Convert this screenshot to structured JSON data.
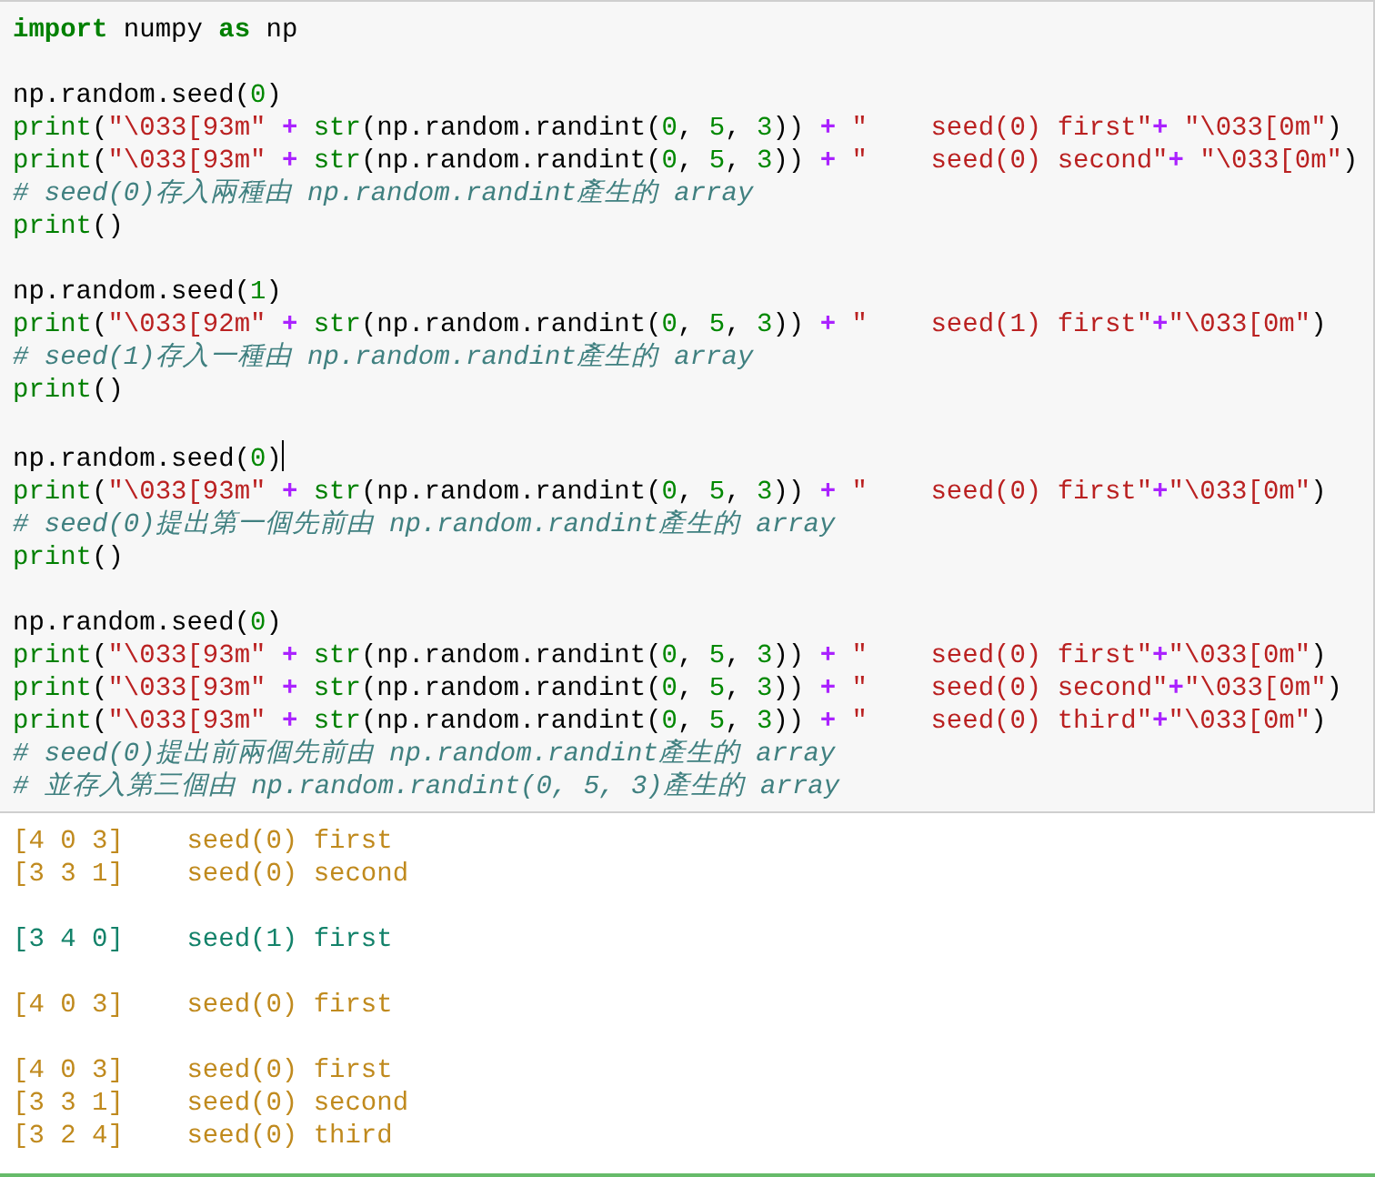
{
  "code_cell": {
    "lines": [
      {
        "tokens": [
          {
            "kind": "keyword",
            "text": "import"
          },
          {
            "kind": "name",
            "text": " numpy "
          },
          {
            "kind": "keyword",
            "text": "as"
          },
          {
            "kind": "name",
            "text": " np"
          }
        ]
      },
      {
        "blank_before": true,
        "tokens": [
          {
            "kind": "name",
            "text": "np.random.seed("
          },
          {
            "kind": "number",
            "text": "0"
          },
          {
            "kind": "name",
            "text": ")"
          }
        ]
      },
      {
        "tokens": [
          {
            "kind": "builtin",
            "text": "print"
          },
          {
            "kind": "name",
            "text": "("
          },
          {
            "kind": "string",
            "text": "\"\\033[93m\" "
          },
          {
            "kind": "operator",
            "text": "+ "
          },
          {
            "kind": "builtin",
            "text": "str"
          },
          {
            "kind": "name",
            "text": "(np.random.randint("
          },
          {
            "kind": "number",
            "text": "0"
          },
          {
            "kind": "name",
            "text": ", "
          },
          {
            "kind": "number",
            "text": "5"
          },
          {
            "kind": "name",
            "text": ", "
          },
          {
            "kind": "number",
            "text": "3"
          },
          {
            "kind": "name",
            "text": ")) "
          },
          {
            "kind": "operator",
            "text": "+ "
          },
          {
            "kind": "string",
            "text": "\"    seed(0) first\""
          },
          {
            "kind": "operator",
            "text": "+ "
          },
          {
            "kind": "string",
            "text": "\"\\033[0m\""
          },
          {
            "kind": "name",
            "text": ")"
          }
        ]
      },
      {
        "tokens": [
          {
            "kind": "builtin",
            "text": "print"
          },
          {
            "kind": "name",
            "text": "("
          },
          {
            "kind": "string",
            "text": "\"\\033[93m\" "
          },
          {
            "kind": "operator",
            "text": "+ "
          },
          {
            "kind": "builtin",
            "text": "str"
          },
          {
            "kind": "name",
            "text": "(np.random.randint("
          },
          {
            "kind": "number",
            "text": "0"
          },
          {
            "kind": "name",
            "text": ", "
          },
          {
            "kind": "number",
            "text": "5"
          },
          {
            "kind": "name",
            "text": ", "
          },
          {
            "kind": "number",
            "text": "3"
          },
          {
            "kind": "name",
            "text": ")) "
          },
          {
            "kind": "operator",
            "text": "+ "
          },
          {
            "kind": "string",
            "text": "\"    seed(0) second\""
          },
          {
            "kind": "operator",
            "text": "+ "
          },
          {
            "kind": "string",
            "text": "\"\\033[0m\""
          },
          {
            "kind": "name",
            "text": ")"
          }
        ]
      },
      {
        "tokens": [
          {
            "kind": "comment",
            "text": "# seed(0)存入兩種由 np.random.randint產生的 array"
          }
        ]
      },
      {
        "tokens": [
          {
            "kind": "builtin",
            "text": "print"
          },
          {
            "kind": "name",
            "text": "()"
          }
        ]
      },
      {
        "blank_before": true,
        "tokens": [
          {
            "kind": "name",
            "text": "np.random.seed("
          },
          {
            "kind": "number",
            "text": "1"
          },
          {
            "kind": "name",
            "text": ")"
          }
        ]
      },
      {
        "tokens": [
          {
            "kind": "builtin",
            "text": "print"
          },
          {
            "kind": "name",
            "text": "("
          },
          {
            "kind": "string",
            "text": "\"\\033[92m\" "
          },
          {
            "kind": "operator",
            "text": "+ "
          },
          {
            "kind": "builtin",
            "text": "str"
          },
          {
            "kind": "name",
            "text": "(np.random.randint("
          },
          {
            "kind": "number",
            "text": "0"
          },
          {
            "kind": "name",
            "text": ", "
          },
          {
            "kind": "number",
            "text": "5"
          },
          {
            "kind": "name",
            "text": ", "
          },
          {
            "kind": "number",
            "text": "3"
          },
          {
            "kind": "name",
            "text": ")) "
          },
          {
            "kind": "operator",
            "text": "+ "
          },
          {
            "kind": "string",
            "text": "\"    seed(1) first\""
          },
          {
            "kind": "operator",
            "text": "+"
          },
          {
            "kind": "string",
            "text": "\"\\033[0m\""
          },
          {
            "kind": "name",
            "text": ")"
          }
        ]
      },
      {
        "tokens": [
          {
            "kind": "comment",
            "text": "# seed(1)存入一種由 np.random.randint產生的 array"
          }
        ]
      },
      {
        "tokens": [
          {
            "kind": "builtin",
            "text": "print"
          },
          {
            "kind": "name",
            "text": "()"
          }
        ]
      },
      {
        "blank_before": true,
        "cursor": true,
        "tokens": [
          {
            "kind": "name",
            "text": "np.random.seed("
          },
          {
            "kind": "number",
            "text": "0"
          },
          {
            "kind": "name",
            "text": ")"
          }
        ]
      },
      {
        "tokens": [
          {
            "kind": "builtin",
            "text": "print"
          },
          {
            "kind": "name",
            "text": "("
          },
          {
            "kind": "string",
            "text": "\"\\033[93m\" "
          },
          {
            "kind": "operator",
            "text": "+ "
          },
          {
            "kind": "builtin",
            "text": "str"
          },
          {
            "kind": "name",
            "text": "(np.random.randint("
          },
          {
            "kind": "number",
            "text": "0"
          },
          {
            "kind": "name",
            "text": ", "
          },
          {
            "kind": "number",
            "text": "5"
          },
          {
            "kind": "name",
            "text": ", "
          },
          {
            "kind": "number",
            "text": "3"
          },
          {
            "kind": "name",
            "text": ")) "
          },
          {
            "kind": "operator",
            "text": "+ "
          },
          {
            "kind": "string",
            "text": "\"    seed(0) first\""
          },
          {
            "kind": "operator",
            "text": "+"
          },
          {
            "kind": "string",
            "text": "\"\\033[0m\""
          },
          {
            "kind": "name",
            "text": ")"
          }
        ]
      },
      {
        "tokens": [
          {
            "kind": "comment",
            "text": "# seed(0)提出第一個先前由 np.random.randint產生的 array"
          }
        ]
      },
      {
        "tokens": [
          {
            "kind": "builtin",
            "text": "print"
          },
          {
            "kind": "name",
            "text": "()"
          }
        ]
      },
      {
        "blank_before": true,
        "tokens": [
          {
            "kind": "name",
            "text": "np.random.seed("
          },
          {
            "kind": "number",
            "text": "0"
          },
          {
            "kind": "name",
            "text": ")"
          }
        ]
      },
      {
        "tokens": [
          {
            "kind": "builtin",
            "text": "print"
          },
          {
            "kind": "name",
            "text": "("
          },
          {
            "kind": "string",
            "text": "\"\\033[93m\" "
          },
          {
            "kind": "operator",
            "text": "+ "
          },
          {
            "kind": "builtin",
            "text": "str"
          },
          {
            "kind": "name",
            "text": "(np.random.randint("
          },
          {
            "kind": "number",
            "text": "0"
          },
          {
            "kind": "name",
            "text": ", "
          },
          {
            "kind": "number",
            "text": "5"
          },
          {
            "kind": "name",
            "text": ", "
          },
          {
            "kind": "number",
            "text": "3"
          },
          {
            "kind": "name",
            "text": ")) "
          },
          {
            "kind": "operator",
            "text": "+ "
          },
          {
            "kind": "string",
            "text": "\"    seed(0) first\""
          },
          {
            "kind": "operator",
            "text": "+"
          },
          {
            "kind": "string",
            "text": "\"\\033[0m\""
          },
          {
            "kind": "name",
            "text": ")"
          }
        ]
      },
      {
        "tokens": [
          {
            "kind": "builtin",
            "text": "print"
          },
          {
            "kind": "name",
            "text": "("
          },
          {
            "kind": "string",
            "text": "\"\\033[93m\" "
          },
          {
            "kind": "operator",
            "text": "+ "
          },
          {
            "kind": "builtin",
            "text": "str"
          },
          {
            "kind": "name",
            "text": "(np.random.randint("
          },
          {
            "kind": "number",
            "text": "0"
          },
          {
            "kind": "name",
            "text": ", "
          },
          {
            "kind": "number",
            "text": "5"
          },
          {
            "kind": "name",
            "text": ", "
          },
          {
            "kind": "number",
            "text": "3"
          },
          {
            "kind": "name",
            "text": ")) "
          },
          {
            "kind": "operator",
            "text": "+ "
          },
          {
            "kind": "string",
            "text": "\"    seed(0) second\""
          },
          {
            "kind": "operator",
            "text": "+"
          },
          {
            "kind": "string",
            "text": "\"\\033[0m\""
          },
          {
            "kind": "name",
            "text": ")"
          }
        ]
      },
      {
        "tokens": [
          {
            "kind": "builtin",
            "text": "print"
          },
          {
            "kind": "name",
            "text": "("
          },
          {
            "kind": "string",
            "text": "\"\\033[93m\" "
          },
          {
            "kind": "operator",
            "text": "+ "
          },
          {
            "kind": "builtin",
            "text": "str"
          },
          {
            "kind": "name",
            "text": "(np.random.randint("
          },
          {
            "kind": "number",
            "text": "0"
          },
          {
            "kind": "name",
            "text": ", "
          },
          {
            "kind": "number",
            "text": "5"
          },
          {
            "kind": "name",
            "text": ", "
          },
          {
            "kind": "number",
            "text": "3"
          },
          {
            "kind": "name",
            "text": ")) "
          },
          {
            "kind": "operator",
            "text": "+ "
          },
          {
            "kind": "string",
            "text": "\"    seed(0) third\""
          },
          {
            "kind": "operator",
            "text": "+"
          },
          {
            "kind": "string",
            "text": "\"\\033[0m\""
          },
          {
            "kind": "name",
            "text": ")"
          }
        ]
      },
      {
        "tokens": [
          {
            "kind": "comment",
            "text": "# seed(0)提出前兩個先前由 np.random.randint產生的 array"
          }
        ]
      },
      {
        "tokens": [
          {
            "kind": "comment",
            "text": "# 並存入第三個由 np.random.randint(0, 5, 3)產生的 array"
          }
        ]
      }
    ]
  },
  "output": {
    "lines": [
      {
        "text": "[4 0 3]    seed(0) first",
        "color": "#c08a1e"
      },
      {
        "text": "[3 3 1]    seed(0) second",
        "color": "#c08a1e"
      },
      {
        "blank_before": true,
        "text": "[3 4 0]    seed(1) first",
        "color": "#13826a"
      },
      {
        "blank_before": true,
        "text": "[4 0 3]    seed(0) first",
        "color": "#c08a1e"
      },
      {
        "blank_before": true,
        "text": "[4 0 3]    seed(0) first",
        "color": "#c08a1e"
      },
      {
        "text": "[3 3 1]    seed(0) second",
        "color": "#c08a1e"
      },
      {
        "text": "[3 2 4]    seed(0) third",
        "color": "#c08a1e"
      }
    ]
  }
}
